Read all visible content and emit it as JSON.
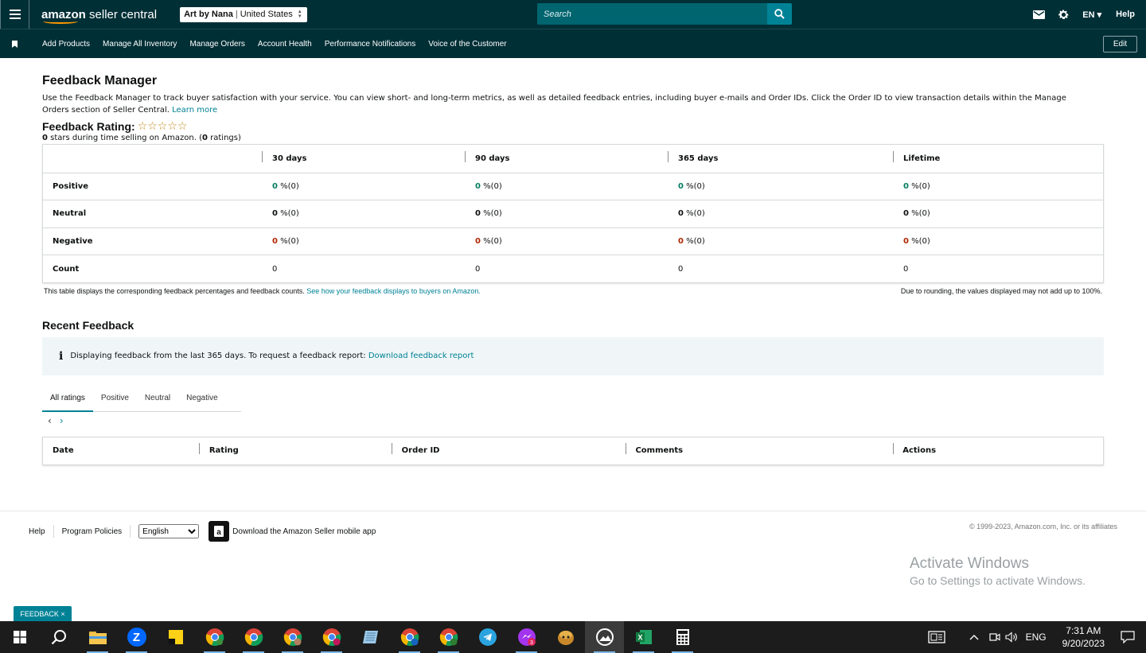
{
  "topbar": {
    "logo_brand": "amazon",
    "logo_product": "seller central",
    "store_name": "Art by Nana",
    "store_region": "United States",
    "search_placeholder": "Search",
    "language": "EN",
    "help": "Help"
  },
  "nav": {
    "items": [
      "Add Products",
      "Manage All Inventory",
      "Manage Orders",
      "Account Health",
      "Performance Notifications",
      "Voice of the Customer"
    ],
    "edit": "Edit"
  },
  "page": {
    "title": "Feedback Manager",
    "intro": "Use the Feedback Manager to track buyer satisfaction with your service. You can view short- and long-term metrics, as well as detailed feedback entries, including buyer e-mails and Order IDs. Click the Order ID to view transaction details within the Manage Orders section of Seller Central.",
    "learn_more": "Learn more",
    "rating_title": "Feedback Rating:",
    "stars_text": "☆☆☆☆☆",
    "stars_value": 0,
    "rating_count_stars": "0",
    "rating_sub_mid": " stars during time selling on Amazon. (",
    "rating_count": "0",
    "rating_sub_end": " ratings)"
  },
  "summary": {
    "headers": [
      "30 days",
      "90 days",
      "365 days",
      "Lifetime"
    ],
    "rows": [
      {
        "label": "Positive",
        "cells": [
          {
            "v": "0",
            "u": " %(0)"
          },
          {
            "v": "0",
            "u": " %(0)"
          },
          {
            "v": "0",
            "u": " %(0)"
          },
          {
            "v": "0",
            "u": " %(0)"
          }
        ]
      },
      {
        "label": "Neutral",
        "cells": [
          {
            "v": "0",
            "u": " %(0)"
          },
          {
            "v": "0",
            "u": " %(0)"
          },
          {
            "v": "0",
            "u": " %(0)"
          },
          {
            "v": "0",
            "u": " %(0)"
          }
        ]
      },
      {
        "label": "Negative",
        "cells": [
          {
            "v": "0",
            "u": " %(0)"
          },
          {
            "v": "0",
            "u": " %(0)"
          },
          {
            "v": "0",
            "u": " %(0)"
          },
          {
            "v": "0",
            "u": " %(0)"
          }
        ]
      },
      {
        "label": "Count",
        "cells": [
          "0",
          "0",
          "0",
          "0"
        ]
      }
    ],
    "note_left": "This table displays the corresponding feedback percentages and feedback counts.",
    "note_left_link": "See how your feedback displays to buyers on Amazon.",
    "note_right": "Due to rounding, the values displayed may not add up to 100%."
  },
  "recent": {
    "title": "Recent Feedback",
    "info_icon": "i",
    "info_text": "Displaying feedback from the last 365 days. To request a feedback report:",
    "info_link": "Download feedback report",
    "tabs": [
      "All ratings",
      "Positive",
      "Neutral",
      "Negative"
    ],
    "prev": "‹",
    "next": "›",
    "columns": [
      "Date",
      "Rating",
      "Order ID",
      "Comments",
      "Actions"
    ]
  },
  "footer": {
    "help": "Help",
    "policies": "Program Policies",
    "language_selected": "English",
    "app_text": "Download the Amazon Seller mobile app",
    "copyright": "© 1999-2023, Amazon.com, Inc. or its affiliates"
  },
  "watermark": {
    "line1": "Activate Windows",
    "line2": "Go to Settings to activate Windows."
  },
  "feedback_tab": "FEEDBACK ×",
  "taskbar": {
    "language": "ENG",
    "time": "7:31 AM",
    "date": "9/20/2023",
    "apps": [
      "start-icon",
      "search-icon",
      "file-explorer-icon",
      "zalo-icon",
      "sticky-notes-icon",
      "chrome-icon",
      "chrome-icon",
      "chrome-profile-icon",
      "chrome-profile-icon",
      "notepad-icon",
      "chrome-profile-icon",
      "chrome-profile-icon",
      "telegram-icon",
      "messenger-icon",
      "game-icon",
      "photos-icon",
      "excel-icon",
      "calculator-icon"
    ]
  },
  "colors": {
    "header_bg": "#002f36",
    "accent": "#008296",
    "positive": "#067d62",
    "negative": "#b12704",
    "star": "#c48a1a"
  }
}
